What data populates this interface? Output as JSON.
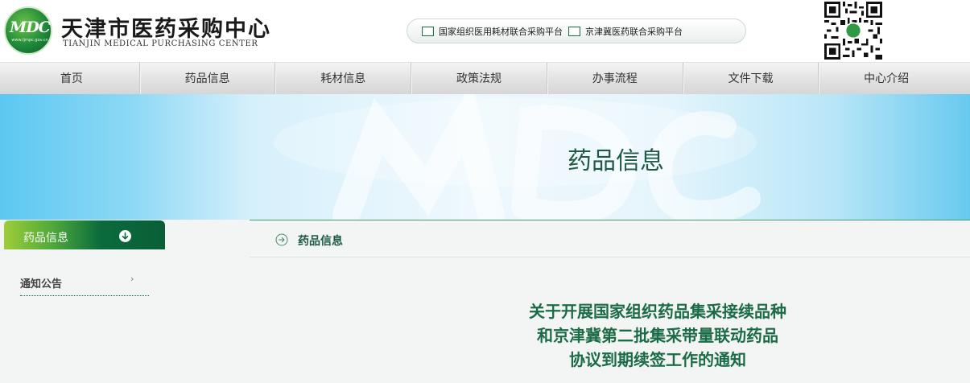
{
  "header": {
    "logo_text": "MDC",
    "logo_url_text": "www.tjmpc.gov.cn",
    "title_cn": "天津市医药采购中心",
    "title_en": "TIANJIN MEDICAL PURCHASING CENTER"
  },
  "platform_links": [
    {
      "label": "国家组织医用耗材联合采购平台"
    },
    {
      "label": "京津冀医药联合采购平台"
    }
  ],
  "nav": {
    "items": [
      {
        "label": "首页"
      },
      {
        "label": "药品信息"
      },
      {
        "label": "耗材信息"
      },
      {
        "label": "政策法规"
      },
      {
        "label": "办事流程"
      },
      {
        "label": "文件下载"
      },
      {
        "label": "中心介绍"
      }
    ]
  },
  "banner": {
    "title": "药品信息"
  },
  "sidebar": {
    "header_label": "药品信息",
    "header_icon": "arrow-down-circle-icon",
    "items": [
      {
        "label": "通知公告",
        "icon": "chevron-right-icon"
      }
    ]
  },
  "content": {
    "section_icon": "arrow-right-circle-icon",
    "section_label": "药品信息",
    "article_title_lines": [
      "关于开展国家组织药品集采接续品种",
      "和京津冀第二批集采带量联动药品",
      "协议到期续签工作的通知"
    ]
  },
  "colors": {
    "brand_green": "#0b6b3d",
    "title_green": "#1b6b46",
    "banner_blue": "#5cc8f2"
  }
}
